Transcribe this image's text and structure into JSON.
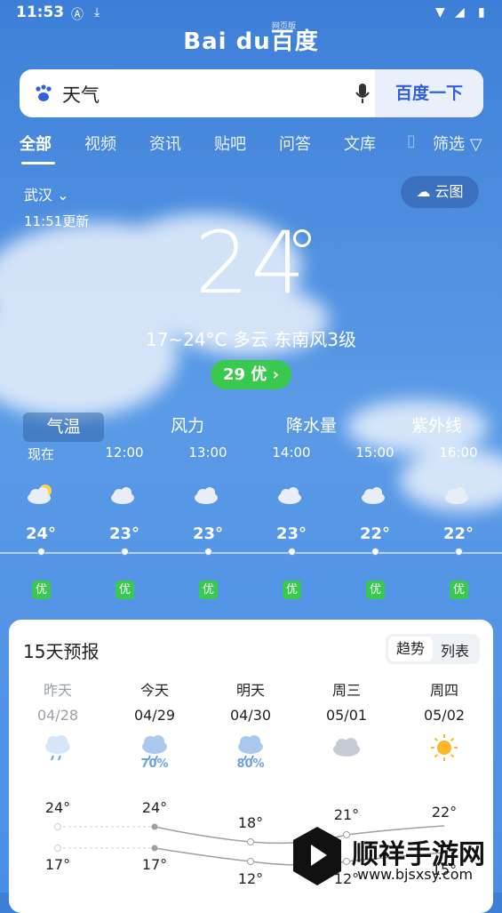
{
  "status_bar": {
    "time": "11:53"
  },
  "logo": {
    "text": "Bai du百度",
    "tag": "网页版"
  },
  "search": {
    "query": "天气",
    "button": "百度一下"
  },
  "tabs": [
    "全部",
    "视频",
    "资讯",
    "贴吧",
    "问答",
    "文库"
  ],
  "filter_label": "筛选",
  "location": {
    "city": "武汉",
    "updated": "11:51更新",
    "cloud_map": "云图"
  },
  "now": {
    "temp": "24",
    "summary": "17~24°C  多云  东南风3级",
    "aqi": "29 优"
  },
  "switcher": [
    "气温",
    "风力",
    "降水量",
    "紫外线"
  ],
  "hourly": [
    {
      "time": "现在",
      "temp": "24°",
      "aqi": "优",
      "icon": "partly-cloudy-icon"
    },
    {
      "time": "12:00",
      "temp": "23°",
      "aqi": "优",
      "icon": "cloudy-icon"
    },
    {
      "time": "13:00",
      "temp": "23°",
      "aqi": "优",
      "icon": "cloudy-icon"
    },
    {
      "time": "14:00",
      "temp": "23°",
      "aqi": "优",
      "icon": "cloudy-icon"
    },
    {
      "time": "15:00",
      "temp": "22°",
      "aqi": "优",
      "icon": "cloudy-icon"
    },
    {
      "time": "16:00",
      "temp": "22°",
      "aqi": "优",
      "icon": "cloudy-icon"
    }
  ],
  "forecast": {
    "title": "15天预报",
    "views": [
      "趋势",
      "列表"
    ],
    "days": [
      {
        "name": "昨天",
        "date": "04/28",
        "icon": "rain-icon",
        "precip": "",
        "high": "24°",
        "low": "17°"
      },
      {
        "name": "今天",
        "date": "04/29",
        "icon": "rain-icon",
        "precip": "70%",
        "high": "24°",
        "low": "17°"
      },
      {
        "name": "明天",
        "date": "04/30",
        "icon": "rain-icon",
        "precip": "80%",
        "high": "18°",
        "low": "12°"
      },
      {
        "name": "周三",
        "date": "05/01",
        "icon": "cloudy-icon",
        "precip": "",
        "high": "21°",
        "low": "12°"
      },
      {
        "name": "周四",
        "date": "05/02",
        "icon": "sun-icon",
        "precip": "",
        "high": "22°",
        "low": "15°"
      }
    ]
  },
  "watermark": {
    "title": "顺祥手游网",
    "url": "www.bjsxsy.com"
  }
}
